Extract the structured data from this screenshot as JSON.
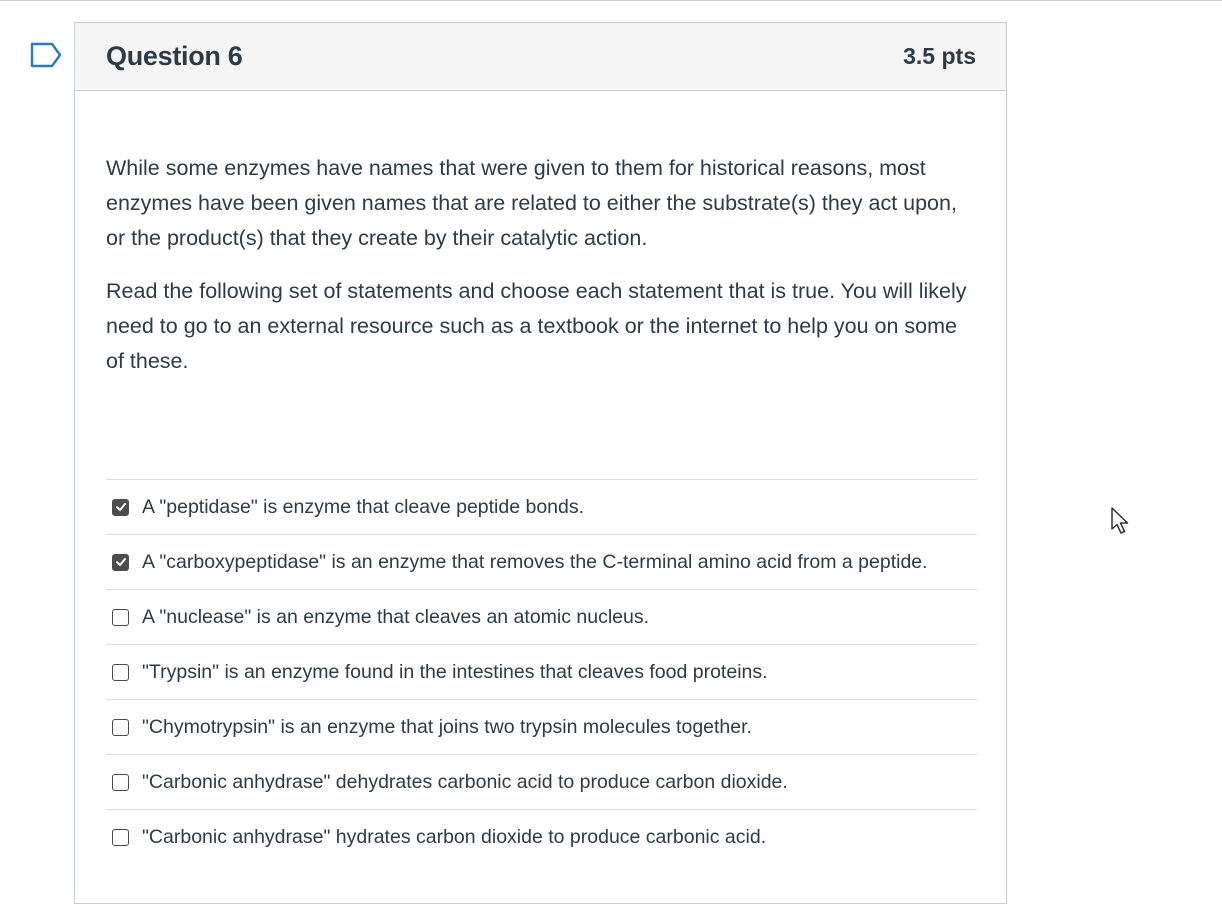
{
  "question": {
    "title": "Question 6",
    "points": "3.5 pts",
    "paragraphs": [
      "While some enzymes have names that were given to them for historical reasons, most enzymes have been given names that are related to either the substrate(s) they act upon, or the product(s) that they create by their catalytic action.",
      "Read the following set of statements and choose each statement that is true.  You will likely need to go to an external resource such as a textbook or the internet to help you on some of these."
    ],
    "answers": [
      {
        "label": "A \"peptidase\" is enzyme that cleave peptide bonds.",
        "checked": true
      },
      {
        "label": "A \"carboxypeptidase\" is an enzyme that removes the C-terminal amino acid from a peptide.",
        "checked": true
      },
      {
        "label": "A \"nuclease\" is an enzyme that cleaves an atomic nucleus.",
        "checked": false
      },
      {
        "label": "\"Trypsin\" is an enzyme found in the intestines that cleaves food proteins.",
        "checked": false
      },
      {
        "label": "\"Chymotrypsin\" is an enzyme that joins two trypsin molecules together.",
        "checked": false
      },
      {
        "label": "\"Carbonic anhydrase\" dehydrates carbonic acid to produce carbon dioxide.",
        "checked": false
      },
      {
        "label": "\"Carbonic anhydrase\" hydrates carbon dioxide to produce carbonic acid.",
        "checked": false
      }
    ]
  },
  "icons": {
    "flag": "flag-icon",
    "cursor": "mouse-pointer-icon",
    "check": "checkmark-icon"
  },
  "colors": {
    "flag": "#2b7abc",
    "text": "#2d3b45",
    "header_bg": "#f5f5f5",
    "border": "#c7cdd1",
    "checkbox_checked": "#4d4d4d"
  }
}
